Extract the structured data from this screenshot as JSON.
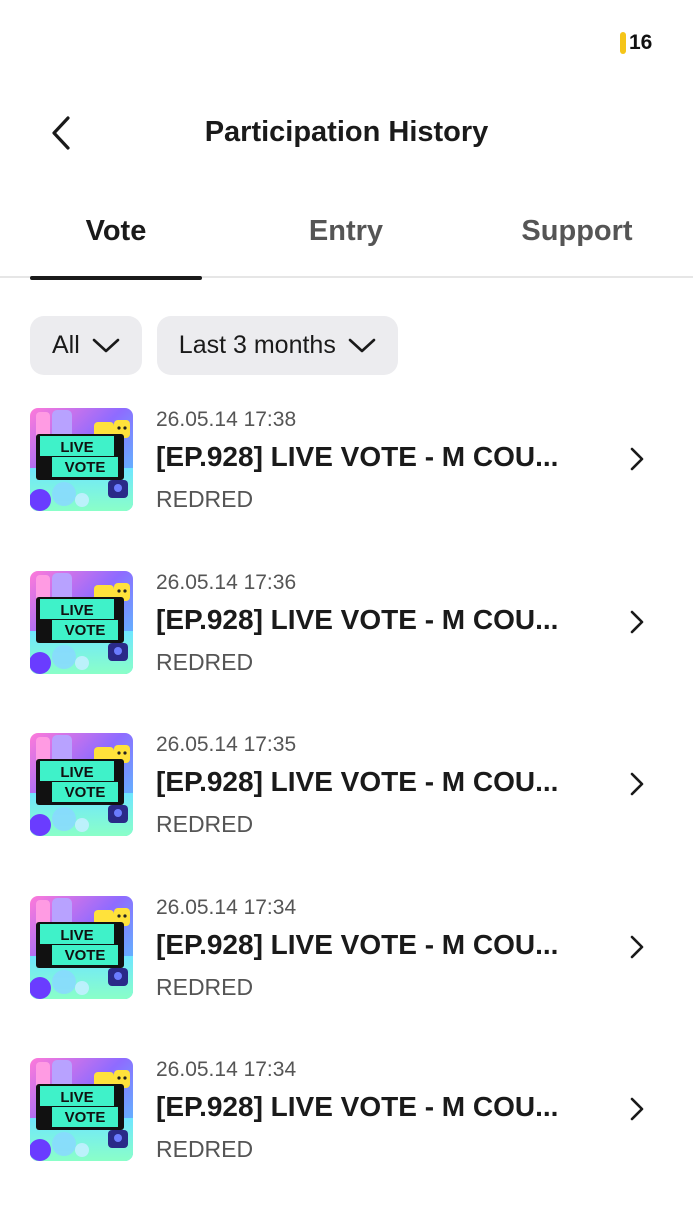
{
  "status": {
    "battery_text": "16",
    "battery_color": "#f5c518"
  },
  "header": {
    "title": "Participation History",
    "back_icon": "chevron-left-icon"
  },
  "tabs": [
    {
      "label": "Vote",
      "active": true
    },
    {
      "label": "Entry",
      "active": false
    },
    {
      "label": "Support",
      "active": false
    }
  ],
  "filters": {
    "type": {
      "label": "All",
      "icon": "chevron-down-icon"
    },
    "period": {
      "label": "Last 3 months",
      "icon": "chevron-down-icon"
    }
  },
  "thumbnail": {
    "badge_line1": "LIVE",
    "badge_line2": "VOTE"
  },
  "items": [
    {
      "date": "26.05.14 17:38",
      "title": "[EP.928] LIVE VOTE - M COU...",
      "artist": "REDRED"
    },
    {
      "date": "26.05.14 17:36",
      "title": "[EP.928] LIVE VOTE - M COU...",
      "artist": "REDRED"
    },
    {
      "date": "26.05.14 17:35",
      "title": "[EP.928] LIVE VOTE - M COU...",
      "artist": "REDRED"
    },
    {
      "date": "26.05.14 17:34",
      "title": "[EP.928] LIVE VOTE - M COU...",
      "artist": "REDRED"
    },
    {
      "date": "26.05.14 17:34",
      "title": "[EP.928] LIVE VOTE - M COU...",
      "artist": "REDRED"
    }
  ]
}
